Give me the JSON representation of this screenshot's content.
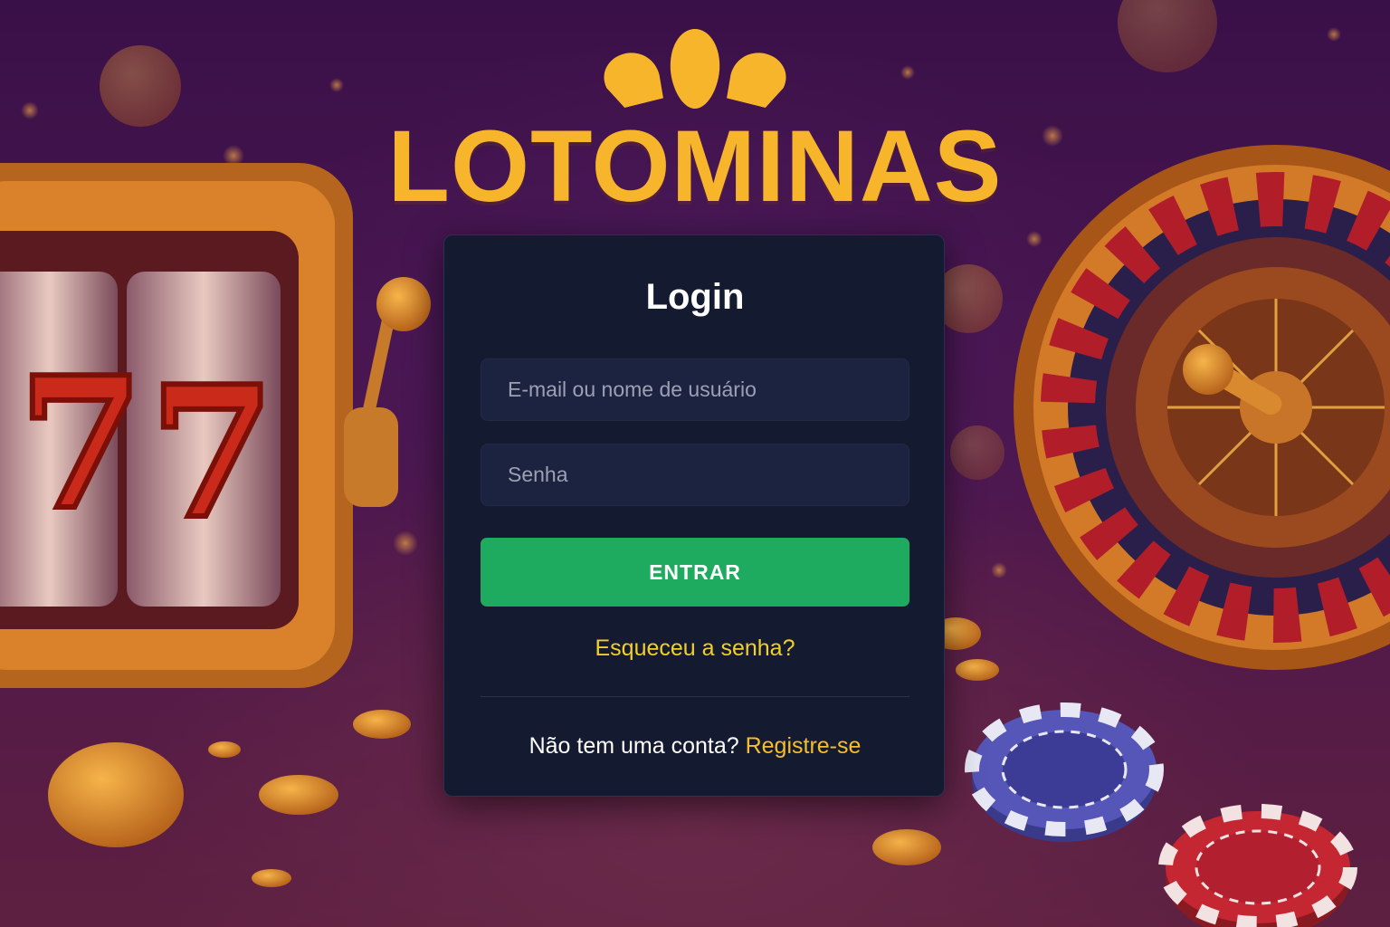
{
  "brand": {
    "name": "LOTOMINAS",
    "color": "#f7b52c"
  },
  "login": {
    "title": "Login",
    "email_placeholder": "E-mail ou nome de usuário",
    "password_placeholder": "Senha",
    "submit_label": "ENTRAR",
    "forgot_label": "Esqueceu a senha?",
    "no_account_text": "Não tem uma conta?",
    "register_label": "Registre-se"
  },
  "colors": {
    "card_bg": "#141a30",
    "input_bg": "#1c2340",
    "button_green": "#1eab5f",
    "link_yellow": "#f3cf2a"
  },
  "icons": [
    "crown-logo-icon",
    "slot-machine-icon",
    "roulette-wheel-icon",
    "casino-chip-icon",
    "gold-coin-icon"
  ]
}
